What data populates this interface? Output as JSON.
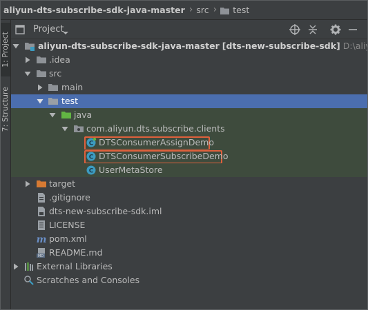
{
  "breadcrumb": {
    "project": "aliyun-dts-subscribe-sdk-java-master",
    "src": "src",
    "test": "test"
  },
  "left_strip": {
    "project_tab": "1: Project",
    "structure_tab": "7: Structure"
  },
  "project_panel": {
    "title": "Project"
  },
  "tree": {
    "root_name": "aliyun-dts-subscribe-sdk-java-master",
    "root_module": "[dts-new-subscribe-sdk]",
    "root_path": "D:\\aliyun-dts-sub",
    "idea": ".idea",
    "src": "src",
    "main": "main",
    "test": "test",
    "java": "java",
    "package": "com.aliyun.dts.subscribe.clients",
    "class1": "DTSConsumerAssignDemo",
    "class2": "DTSConsumerSubscribeDemo",
    "class3": "UserMetaStore",
    "target": "target",
    "gitignore": ".gitignore",
    "iml": "dts-new-subscribe-sdk.iml",
    "license": "LICENSE",
    "pom": "pom.xml",
    "readme": "README.md",
    "ext_libs": "External Libraries",
    "scratches": "Scratches and Consoles"
  },
  "colors": {
    "background": "#3c3f41",
    "selection": "#4b6eaf",
    "test_folder_bg": "#3e4b3d",
    "highlight_box": "#e0603c",
    "class_icon": "#3c9bc0"
  }
}
